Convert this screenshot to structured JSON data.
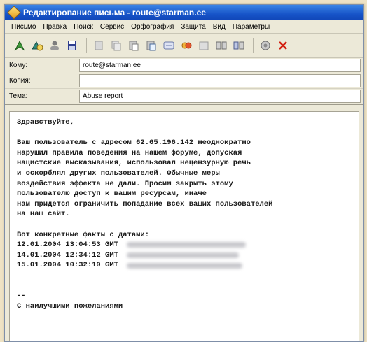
{
  "window": {
    "title": "Редактирование письма - route@starman.ee",
    "colors": {
      "titlebar": "#1754c8",
      "chrome": "#ece9d8",
      "close_icon": "#d21f10"
    }
  },
  "menu": [
    "Письмо",
    "Правка",
    "Поиск",
    "Сервис",
    "Орфография",
    "Защита",
    "Вид",
    "Параметры"
  ],
  "toolbar": {
    "buttons": [
      "send-icon",
      "send-later-icon",
      "address-book-icon",
      "save-icon",
      "cut-icon",
      "copy-icon",
      "paste-icon",
      "paste-special-icon",
      "reply-icon",
      "attach-icon",
      "insert-icon",
      "format-icon",
      "format-alt-icon",
      "encrypt-icon",
      "delete-icon"
    ]
  },
  "fields": {
    "to_label": "Кому:",
    "to_value": "route@starman.ee",
    "cc_label": "Копия:",
    "cc_value": "",
    "subject_label": "Тема:",
    "subject_value": "Abuse report"
  },
  "body": {
    "greeting": "Здравствуйте,",
    "para": [
      "Ваш пользователь с адресом 62.65.196.142 неоднократно",
      "нарушил правила поведения на нашем форуме, допуская",
      "нацистские высказывания, использовал нецензурную речь",
      "и оскорблял других пользователей. Обычные меры",
      "воздействия эффекта не дали. Просим закрыть этому",
      "пользователю доступ к вашим ресурсам, иначе",
      "нам придется ограничить попадание всех ваших пользователей",
      "на наш сайт."
    ],
    "facts_header": "Вот конкретные факты с датами:",
    "facts": [
      "12.01.2004 13:04:53 GMT",
      "14.01.2004 12:34:12 GMT",
      "15.01.2004 10:32:10 GMT"
    ],
    "sig_sep": "--",
    "sig_line": "С наилучшими пожеланиями"
  }
}
